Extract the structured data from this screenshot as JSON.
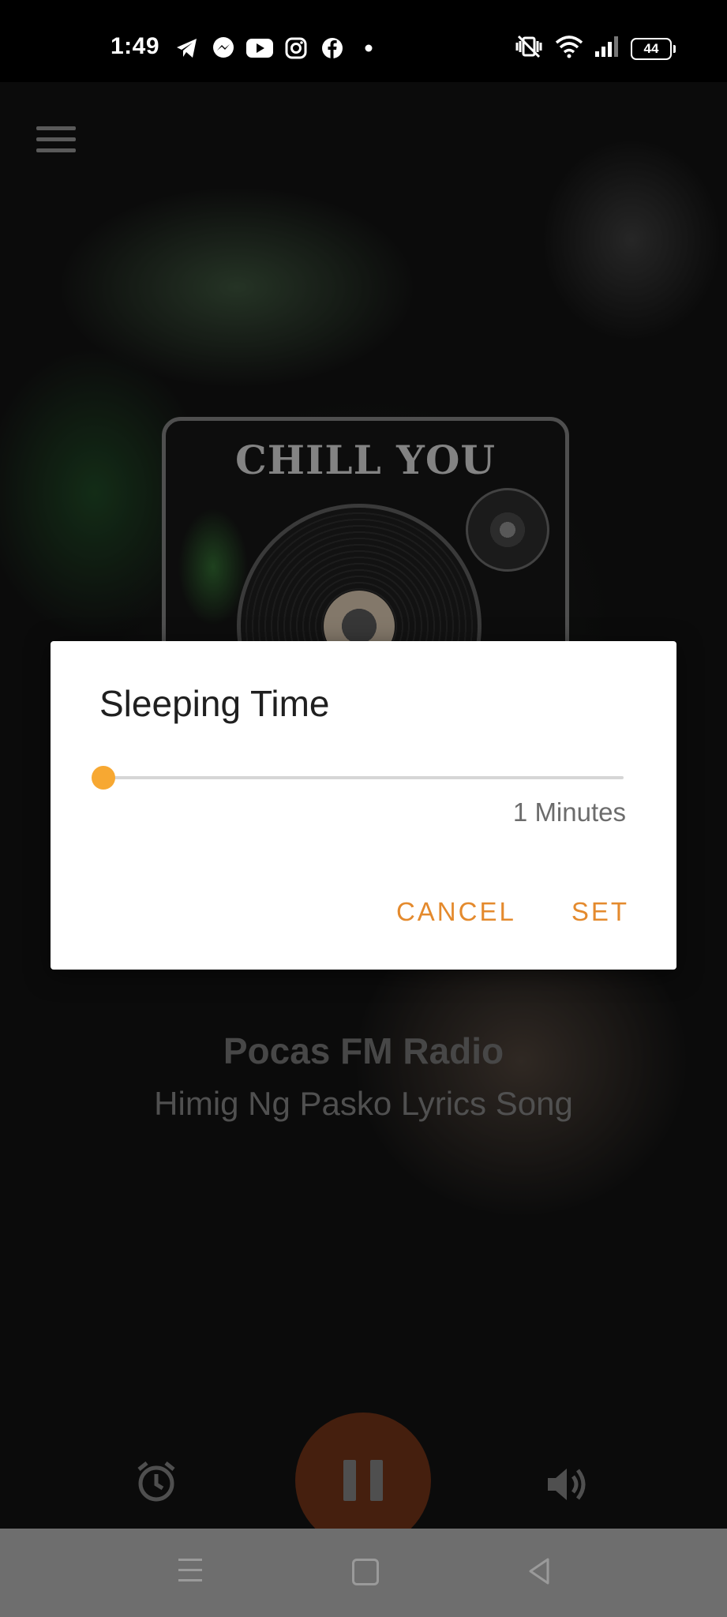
{
  "status_bar": {
    "time": "1:49",
    "app_icons": [
      "telegram-icon",
      "messenger-icon",
      "youtube-icon",
      "instagram-icon",
      "facebook-icon",
      "dot-icon"
    ],
    "right_icons": [
      "vibrate-mute-icon",
      "wifi-icon",
      "signal-icon"
    ],
    "battery": "44"
  },
  "player": {
    "album_title": "CHILL YOU",
    "station_name": "Pocas FM Radio",
    "song_title": "Himig Ng Pasko Lyrics Song",
    "accent_color": "#6a3016"
  },
  "dialog": {
    "title": "Sleeping Time",
    "slider_value_fraction": 0.0,
    "slider_label": "1 Minutes",
    "cancel_label": "CANCEL",
    "set_label": "SET",
    "accent_color": "#e48a2d",
    "thumb_color": "#f7a832"
  },
  "nav_bar": {
    "icons": [
      "recents-icon",
      "home-icon",
      "back-icon"
    ]
  }
}
